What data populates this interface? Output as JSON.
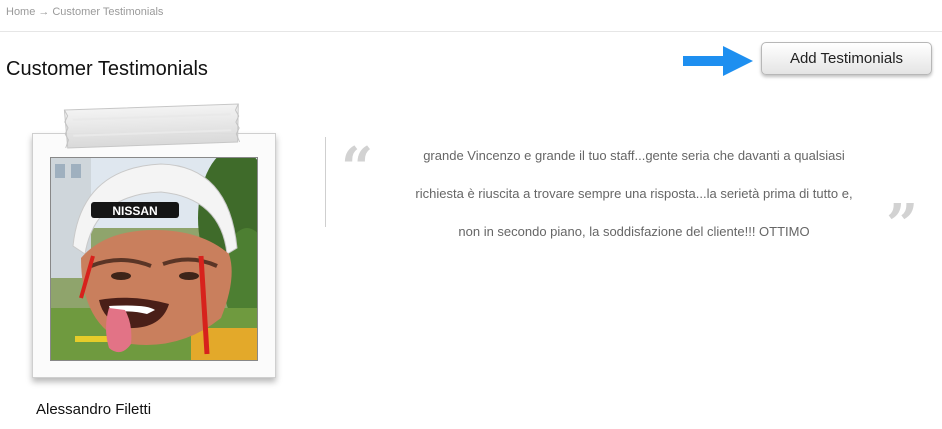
{
  "breadcrumb": {
    "home": "Home",
    "separator": "→",
    "current": "Customer Testimonials"
  },
  "page": {
    "title": "Customer Testimonials"
  },
  "toolbar": {
    "add_label": "Add Testimonials"
  },
  "testimonial": {
    "author": "Alessandro Filetti",
    "lines": [
      "grande Vincenzo e grande il tuo staff...gente seria che davanti a qualsiasi",
      "richiesta è riuscita a trovare sempre una risposta...la serietà prima di tutto e,",
      "non in secondo piano, la soddisfazione del cliente!!! OTTIMO"
    ],
    "quote_open": "“",
    "quote_close": "”"
  },
  "helmet_text": "NISSAN",
  "colors": {
    "arrow": "#1e8ff0",
    "quote_marks": "#d2d2d2",
    "quote_text": "#666666",
    "breadcrumb": "#9a9a9a"
  },
  "icons": {
    "arrow": "arrow-right-icon"
  }
}
